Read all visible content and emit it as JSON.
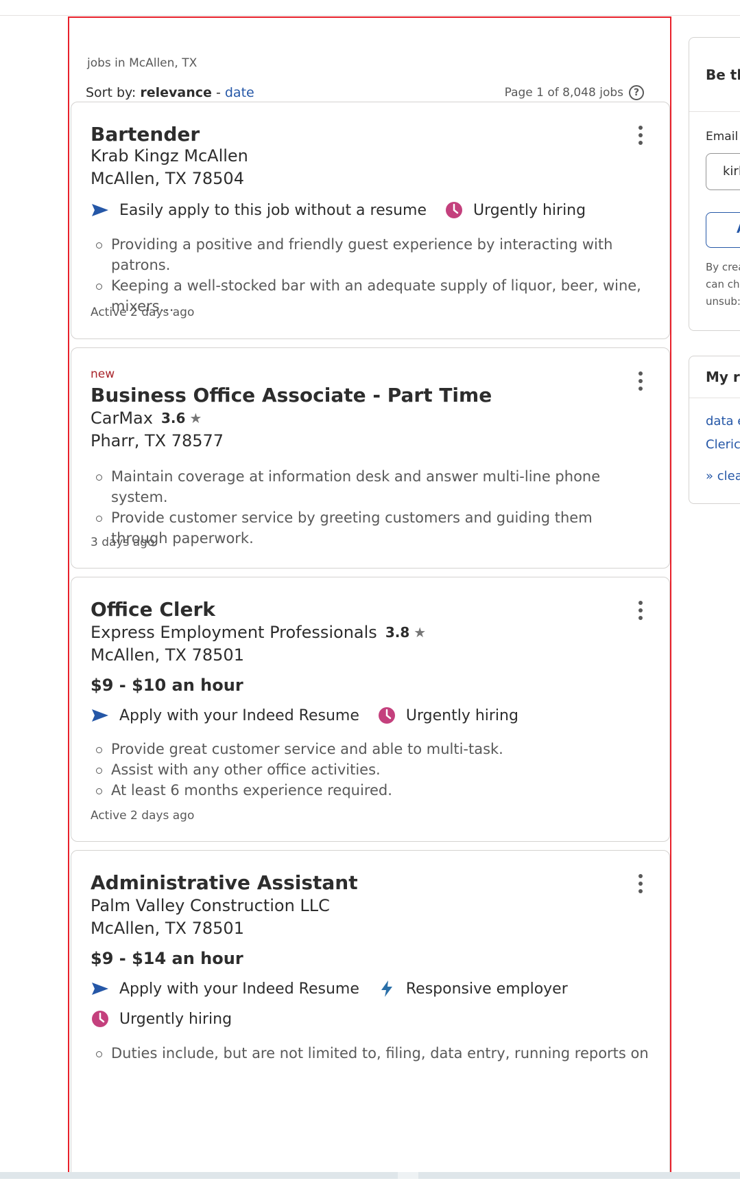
{
  "results": {
    "subtitle": "jobs in McAllen, TX",
    "sort_label": "Sort by:",
    "sort_relevance": "relevance",
    "sort_separator": "-",
    "sort_date": "date",
    "page_count": "Page 1 of 8,048 jobs",
    "help_icon": "?"
  },
  "jobs": [
    {
      "title": "Bartender",
      "company": "Krab Kingz McAllen",
      "location": "McAllen, TX 78504",
      "attr_apply": "Easily apply to this job without a resume",
      "attr_urgent": "Urgently hiring",
      "snippet": [
        "Providing a positive and friendly guest experience by interacting with patrons.",
        "Keeping a well-stocked bar with an adequate supply of liquor, beer, wine, mixers…"
      ],
      "posted": "Active 2 days ago"
    },
    {
      "badge": "new",
      "title": "Business Office Associate - Part Time",
      "company": "CarMax",
      "rating": "3.6",
      "location": "Pharr, TX 78577",
      "snippet": [
        "Maintain coverage at information desk and answer multi-line phone system.",
        "Provide customer service by greeting customers and guiding them through paperwork."
      ],
      "posted": "3 days ago"
    },
    {
      "title": "Office Clerk",
      "company": "Express Employment Professionals",
      "rating": "3.8",
      "location": "McAllen, TX 78501",
      "salary": "$9 - $10 an hour",
      "attr_apply": "Apply with your Indeed Resume",
      "attr_urgent": "Urgently hiring",
      "snippet": [
        "Provide great customer service and able to multi-task.",
        "Assist with any other office activities.",
        "At least 6 months experience required."
      ],
      "posted": "Active 2 days ago"
    },
    {
      "title": "Administrative Assistant",
      "company": "Palm Valley Construction LLC",
      "location": "McAllen, TX 78501",
      "salary": "$9 - $14 an hour",
      "attr_apply": "Apply with your Indeed Resume",
      "attr_responsive": "Responsive employer",
      "attr_urgent": "Urgently hiring",
      "snippet": [
        "Duties include, but are not limited to, filing, data entry, running reports on"
      ]
    }
  ],
  "sidebar": {
    "alert_heading": "Be th",
    "email_label": "Email",
    "email_value": "kirl",
    "button_label": "A",
    "legal_lines": [
      "By crea",
      "can ch",
      "unsub:"
    ],
    "recent_heading": "My re",
    "recent_links": [
      "data e",
      "Cleric"
    ],
    "clear_link": "» clear"
  },
  "colors": {
    "link": "#2557a7",
    "urgent": "#c4407d",
    "responsive": "#2a6fa8",
    "new_badge": "#a9252b",
    "highlight_border": "#e8202a"
  }
}
